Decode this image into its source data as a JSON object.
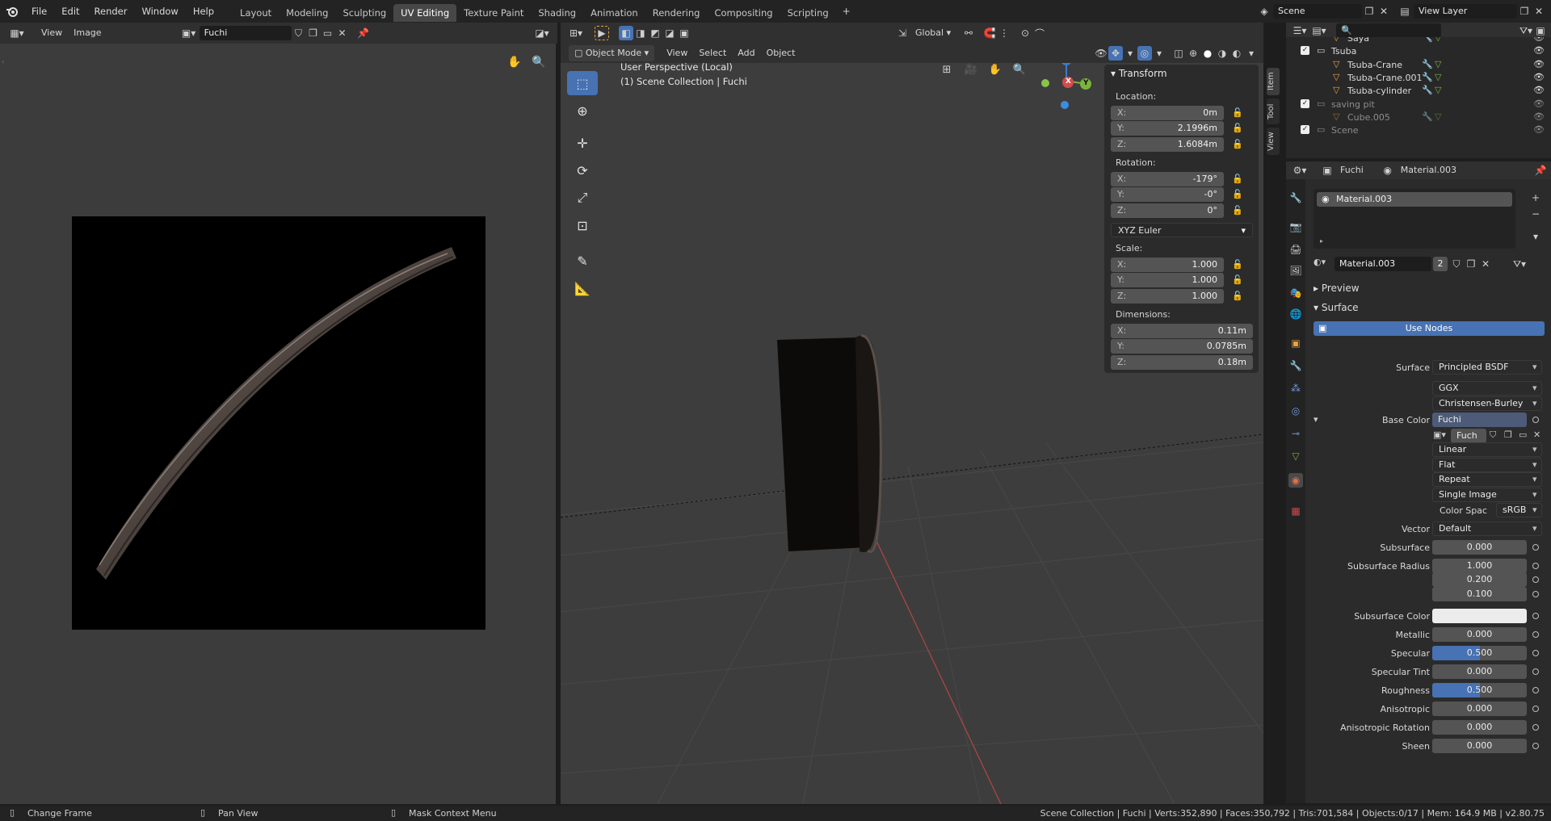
{
  "topbar": {
    "menus": [
      "File",
      "Edit",
      "Render",
      "Window",
      "Help"
    ],
    "workspaces": [
      "Layout",
      "Modeling",
      "Sculpting",
      "UV Editing",
      "Texture Paint",
      "Shading",
      "Animation",
      "Rendering",
      "Compositing",
      "Scripting"
    ],
    "active_workspace": "UV Editing",
    "scene_name": "Scene",
    "view_layer": "View Layer"
  },
  "uv_editor": {
    "menu_view": "View",
    "menu_image": "Image",
    "image_name": "Fuchi"
  },
  "viewport": {
    "mode": "Object Mode",
    "menus": [
      "View",
      "Select",
      "Add",
      "Object"
    ],
    "orientation": "Global",
    "info_line1": "User Perspective (Local)",
    "info_line2": "(1) Scene Collection | Fuchi",
    "gizmo_x": "X",
    "gizmo_y": "Y",
    "gizmo_z": "Z"
  },
  "transform": {
    "title": "Transform",
    "location_label": "Location:",
    "location": {
      "x": "0m",
      "y": "2.1996m",
      "z": "1.6084m"
    },
    "rotation_label": "Rotation:",
    "rotation": {
      "x": "-179°",
      "y": "-0°",
      "z": "0°"
    },
    "rotation_mode": "XYZ Euler",
    "scale_label": "Scale:",
    "scale": {
      "x": "1.000",
      "y": "1.000",
      "z": "1.000"
    },
    "dimensions_label": "Dimensions:",
    "dimensions": {
      "x": "0.11m",
      "y": "0.0785m",
      "z": "0.18m"
    },
    "axis_x": "X:",
    "axis_y": "Y:",
    "axis_z": "Z:"
  },
  "side_tabs": [
    "Item",
    "Tool",
    "View"
  ],
  "outliner": {
    "items": [
      {
        "name": "Saya",
        "level": 2
      },
      {
        "name": "Tsuba",
        "level": 1
      },
      {
        "name": "Tsuba-Crane",
        "level": 2
      },
      {
        "name": "Tsuba-Crane.001",
        "level": 2
      },
      {
        "name": "Tsuba-cylinder",
        "level": 2
      },
      {
        "name": "saving pit",
        "level": 1
      },
      {
        "name": "Cube.005",
        "level": 2
      },
      {
        "name": "Scene",
        "level": 1
      }
    ]
  },
  "properties": {
    "object_name": "Fuchi",
    "material_name": "Material.003",
    "slot_name": "Material.003",
    "material_users": "2",
    "preview_label": "Preview",
    "surface_header": "Surface",
    "use_nodes": "Use Nodes",
    "rows": [
      {
        "label": "Surface",
        "value": "Principled BSDF",
        "kind": "sel"
      },
      {
        "label": "",
        "value": "GGX",
        "kind": "sel"
      },
      {
        "label": "",
        "value": "Christensen-Burley",
        "kind": "sel"
      },
      {
        "label": "Base Color",
        "value": "Fuchi",
        "kind": "link"
      },
      {
        "label": "",
        "value": "Fuch",
        "kind": "img"
      },
      {
        "label": "",
        "value": "Linear",
        "kind": "sel"
      },
      {
        "label": "",
        "value": "Flat",
        "kind": "sel"
      },
      {
        "label": "",
        "value": "Repeat",
        "kind": "sel"
      },
      {
        "label": "",
        "value": "Single Image",
        "kind": "sel"
      },
      {
        "label": "Color Spac",
        "value": "sRGB",
        "kind": "sel"
      },
      {
        "label": "Vector",
        "value": "Default",
        "kind": "sel"
      },
      {
        "label": "Subsurface",
        "value": "0.000",
        "kind": "num"
      },
      {
        "label": "Subsurface Radius",
        "value": "1.000",
        "kind": "num"
      },
      {
        "label": "",
        "value": "0.200",
        "kind": "num"
      },
      {
        "label": "",
        "value": "0.100",
        "kind": "num"
      },
      {
        "label": "Subsurface Color",
        "value": "",
        "kind": "color"
      },
      {
        "label": "Metallic",
        "value": "0.000",
        "kind": "num"
      },
      {
        "label": "Specular",
        "value": "0.500",
        "kind": "slider"
      },
      {
        "label": "Specular Tint",
        "value": "0.000",
        "kind": "num"
      },
      {
        "label": "Roughness",
        "value": "0.500",
        "kind": "slider"
      },
      {
        "label": "Anisotropic",
        "value": "0.000",
        "kind": "num"
      },
      {
        "label": "Anisotropic Rotation",
        "value": "0.000",
        "kind": "num"
      },
      {
        "label": "Sheen",
        "value": "0.000",
        "kind": "num"
      }
    ],
    "specular_fill": 0.5,
    "roughness_fill": 0.5
  },
  "statusbar": {
    "hint1": "Change Frame",
    "hint2": "Pan View",
    "hint3": "Mask Context Menu",
    "stats": "Scene Collection | Fuchi | Verts:352,890 | Faces:350,792 | Tris:701,584 | Objects:0/17 | Mem: 164.9 MB | v2.80.75"
  },
  "colors": {
    "accent": "#4772b3",
    "header": "#303030",
    "panel": "#2b2b2b",
    "field": "#545454"
  }
}
